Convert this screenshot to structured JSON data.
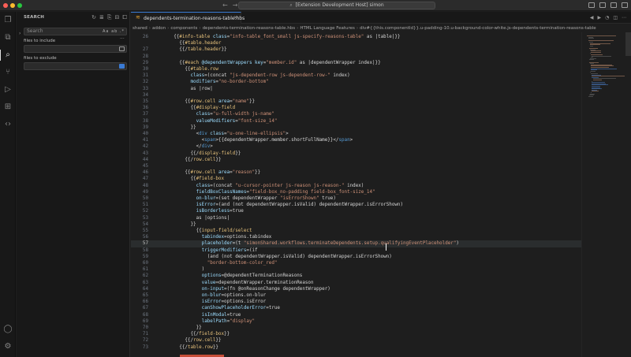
{
  "window": {
    "title": "[Extension Development Host] simon"
  },
  "activity": {
    "icons": [
      "explorer-icon",
      "search-icon",
      "source-control-icon",
      "run-debug-icon",
      "extensions-icon",
      "remote-icon",
      "account-icon",
      "settings-icon"
    ]
  },
  "sidebar": {
    "title": "SEARCH",
    "search_placeholder": "Search",
    "search_options": "Aa ab .*",
    "include_label": "files to include",
    "exclude_label": "files to exclude"
  },
  "tab": {
    "label": "dependents-termination-reasons-table.hbs",
    "close": "×"
  },
  "breadcrumb": [
    "shared",
    "addon",
    "components",
    "dependents-termination-reasons-table.hbs",
    "HTML Language Features",
    "div#{{this.componentId}}.u-padding-10.u-background-color-white.js-dependents-termination-reasons-table"
  ],
  "editor": {
    "current_line": "57",
    "lines": [
      {
        "n": "26",
        "indent": 2,
        "parts": [
          [
            "p",
            "{{"
          ],
          [
            "t",
            "#info-table "
          ],
          [
            "a",
            "class"
          ],
          [
            "p",
            "="
          ],
          [
            "s",
            "\"info-table_font_small js-specify-reasons-table\""
          ],
          [
            "p",
            " as |table|}}"
          ]
        ]
      },
      {
        "n": "",
        "indent": 3,
        "parts": [
          [
            "p",
            "{{"
          ],
          [
            "t",
            "#table.header"
          ]
        ]
      },
      {
        "n": "27",
        "indent": 3,
        "parts": [
          [
            "p",
            "{{/"
          ],
          [
            "t",
            "table.header"
          ],
          [
            "p",
            "}}"
          ]
        ]
      },
      {
        "n": "28",
        "indent": 0,
        "parts": []
      },
      {
        "n": "29",
        "indent": 3,
        "parts": [
          [
            "p",
            "{{"
          ],
          [
            "t",
            "#each "
          ],
          [
            "v",
            "@dependentWrappers "
          ],
          [
            "a",
            "key"
          ],
          [
            "p",
            "="
          ],
          [
            "s",
            "\"member.id\""
          ],
          [
            "p",
            " as |dependentWrapper index|}}"
          ]
        ]
      },
      {
        "n": "30",
        "indent": 4,
        "parts": [
          [
            "p",
            "{{"
          ],
          [
            "t",
            "#table.row"
          ]
        ]
      },
      {
        "n": "31",
        "indent": 5,
        "parts": [
          [
            "a",
            "class"
          ],
          [
            "p",
            "=(concat "
          ],
          [
            "s",
            "\"js-dependent-row js-dependent-row-\""
          ],
          [
            "p",
            " index)"
          ]
        ]
      },
      {
        "n": "32",
        "indent": 5,
        "parts": [
          [
            "a",
            "modifiers"
          ],
          [
            "p",
            "="
          ],
          [
            "s",
            "\"no-border-bottom\""
          ]
        ]
      },
      {
        "n": "33",
        "indent": 5,
        "parts": [
          [
            "p",
            "as |row|"
          ]
        ]
      },
      {
        "n": "34",
        "indent": 4,
        "parts": []
      },
      {
        "n": "35",
        "indent": 4,
        "parts": [
          [
            "p",
            "{{"
          ],
          [
            "t",
            "#row.cell "
          ],
          [
            "a",
            "area"
          ],
          [
            "p",
            "="
          ],
          [
            "s",
            "\"name\""
          ],
          [
            "p",
            "}}"
          ]
        ]
      },
      {
        "n": "36",
        "indent": 5,
        "parts": [
          [
            "p",
            "{{"
          ],
          [
            "t",
            "#display-field"
          ]
        ]
      },
      {
        "n": "37",
        "indent": 6,
        "parts": [
          [
            "a",
            "class"
          ],
          [
            "p",
            "="
          ],
          [
            "s",
            "\"u-full-width js-name\""
          ]
        ]
      },
      {
        "n": "38",
        "indent": 6,
        "parts": [
          [
            "a",
            "valueModifiers"
          ],
          [
            "p",
            "="
          ],
          [
            "s",
            "\"font-size_14\""
          ]
        ]
      },
      {
        "n": "39",
        "indent": 5,
        "parts": [
          [
            "p",
            "}}"
          ]
        ]
      },
      {
        "n": "40",
        "indent": 6,
        "parts": [
          [
            "p",
            "<"
          ],
          [
            "h",
            "div "
          ],
          [
            "a",
            "class"
          ],
          [
            "p",
            "="
          ],
          [
            "s",
            "\"u-one-line-ellipsis\""
          ],
          [
            "p",
            ">"
          ]
        ]
      },
      {
        "n": "41",
        "indent": 7,
        "parts": [
          [
            "p",
            "<"
          ],
          [
            "h",
            "span"
          ],
          [
            "p",
            ">{{dependentWrapper.member.shortFullName}}</"
          ],
          [
            "h",
            "span"
          ],
          [
            "p",
            ">"
          ]
        ]
      },
      {
        "n": "42",
        "indent": 6,
        "parts": [
          [
            "p",
            "</"
          ],
          [
            "h",
            "div"
          ],
          [
            "p",
            ">"
          ]
        ]
      },
      {
        "n": "43",
        "indent": 5,
        "parts": [
          [
            "p",
            "{{/"
          ],
          [
            "t",
            "display-field"
          ],
          [
            "p",
            "}}"
          ]
        ]
      },
      {
        "n": "44",
        "indent": 4,
        "parts": [
          [
            "p",
            "{{/"
          ],
          [
            "t",
            "row.cell"
          ],
          [
            "p",
            "}}"
          ]
        ]
      },
      {
        "n": "45",
        "indent": 0,
        "parts": []
      },
      {
        "n": "46",
        "indent": 4,
        "parts": [
          [
            "p",
            "{{"
          ],
          [
            "t",
            "#row.cell "
          ],
          [
            "a",
            "area"
          ],
          [
            "p",
            "="
          ],
          [
            "s",
            "\"reason\""
          ],
          [
            "p",
            "}}"
          ]
        ]
      },
      {
        "n": "47",
        "indent": 5,
        "parts": [
          [
            "p",
            "{{"
          ],
          [
            "t",
            "#field-box"
          ]
        ]
      },
      {
        "n": "48",
        "indent": 6,
        "parts": [
          [
            "a",
            "class"
          ],
          [
            "p",
            "=(concat "
          ],
          [
            "s",
            "\"u-cursor-pointer js-reason js-reason-\""
          ],
          [
            "p",
            " index)"
          ]
        ]
      },
      {
        "n": "49",
        "indent": 6,
        "parts": [
          [
            "a",
            "fieldBoxClassNames"
          ],
          [
            "p",
            "="
          ],
          [
            "s",
            "\"field-box_no-padding field-box_font-size_14\""
          ]
        ]
      },
      {
        "n": "50",
        "indent": 6,
        "parts": [
          [
            "a",
            "on-blur"
          ],
          [
            "p",
            "=(set dependentWrapper "
          ],
          [
            "s",
            "\"isErrorShown\""
          ],
          [
            "p",
            " true)"
          ]
        ]
      },
      {
        "n": "51",
        "indent": 6,
        "parts": [
          [
            "a",
            "isError"
          ],
          [
            "p",
            "=(and (not dependentWrapper.isValid) dependentWrapper.isErrorShown)"
          ]
        ]
      },
      {
        "n": "52",
        "indent": 6,
        "parts": [
          [
            "a",
            "isBorderless"
          ],
          [
            "p",
            "=true"
          ]
        ]
      },
      {
        "n": "53",
        "indent": 6,
        "parts": [
          [
            "p",
            "as |options|"
          ]
        ]
      },
      {
        "n": "54",
        "indent": 5,
        "parts": [
          [
            "p",
            "}}"
          ]
        ]
      },
      {
        "n": "55",
        "indent": 6,
        "parts": [
          [
            "p",
            "{{"
          ],
          [
            "t",
            "input-field/select"
          ]
        ]
      },
      {
        "n": "56",
        "indent": 7,
        "parts": [
          [
            "a",
            "tabindex"
          ],
          [
            "p",
            "=options.tabindex"
          ]
        ]
      },
      {
        "n": "57",
        "indent": 7,
        "parts": [
          [
            "a",
            "placeholder"
          ],
          [
            "p",
            "=(t "
          ],
          [
            "s",
            "\"simonShared.workflows.terminateDependents.setup.qualifyingEventPlaceholder\""
          ],
          [
            "p",
            ")"
          ]
        ]
      },
      {
        "n": "58",
        "indent": 7,
        "parts": [
          [
            "a",
            "triggerModifiers"
          ],
          [
            "p",
            "=(if"
          ]
        ]
      },
      {
        "n": "59",
        "indent": 8,
        "parts": [
          [
            "p",
            "(and (not dependentWrapper.isValid) dependentWrapper.isErrorShown)"
          ]
        ]
      },
      {
        "n": "60",
        "indent": 8,
        "parts": [
          [
            "s",
            "\"border-bottom-color_red\""
          ]
        ]
      },
      {
        "n": "61",
        "indent": 7,
        "parts": [
          [
            "p",
            ")"
          ]
        ]
      },
      {
        "n": "62",
        "indent": 7,
        "parts": [
          [
            "a",
            "options"
          ],
          [
            "p",
            "=@dependentTerminationReasons"
          ]
        ]
      },
      {
        "n": "63",
        "indent": 7,
        "parts": [
          [
            "a",
            "value"
          ],
          [
            "p",
            "=dependentWrapper.terminationReason"
          ]
        ]
      },
      {
        "n": "64",
        "indent": 7,
        "parts": [
          [
            "a",
            "on-input"
          ],
          [
            "p",
            "=(fn @onReasonChange dependentWrapper)"
          ]
        ]
      },
      {
        "n": "65",
        "indent": 7,
        "parts": [
          [
            "a",
            "on-blur"
          ],
          [
            "p",
            "=options.on-blur"
          ]
        ]
      },
      {
        "n": "66",
        "indent": 7,
        "parts": [
          [
            "a",
            "isError"
          ],
          [
            "p",
            "=options.isError"
          ]
        ]
      },
      {
        "n": "67",
        "indent": 7,
        "parts": [
          [
            "a",
            "canShowPlaceholderError"
          ],
          [
            "p",
            "=true"
          ]
        ]
      },
      {
        "n": "68",
        "indent": 7,
        "parts": [
          [
            "a",
            "isInModal"
          ],
          [
            "p",
            "=true"
          ]
        ]
      },
      {
        "n": "69",
        "indent": 7,
        "parts": [
          [
            "a",
            "labelPath"
          ],
          [
            "p",
            "="
          ],
          [
            "s",
            "\"display\""
          ]
        ]
      },
      {
        "n": "70",
        "indent": 6,
        "parts": [
          [
            "p",
            "}}"
          ]
        ]
      },
      {
        "n": "71",
        "indent": 5,
        "parts": [
          [
            "p",
            "{{/"
          ],
          [
            "t",
            "field-box"
          ],
          [
            "p",
            "}}"
          ]
        ]
      },
      {
        "n": "72",
        "indent": 4,
        "parts": [
          [
            "p",
            "{{/"
          ],
          [
            "t",
            "row.cell"
          ],
          [
            "p",
            "}}"
          ]
        ]
      },
      {
        "n": "73",
        "indent": 3,
        "parts": [
          [
            "p",
            "{{/"
          ],
          [
            "t",
            "table.row"
          ],
          [
            "p",
            "}}"
          ]
        ]
      }
    ]
  },
  "colors": {
    "accent": "#3a7bd5",
    "tag": "#e5c07b",
    "attr": "#9cdcfe",
    "string": "#ce9178",
    "html": "#569cd6"
  }
}
